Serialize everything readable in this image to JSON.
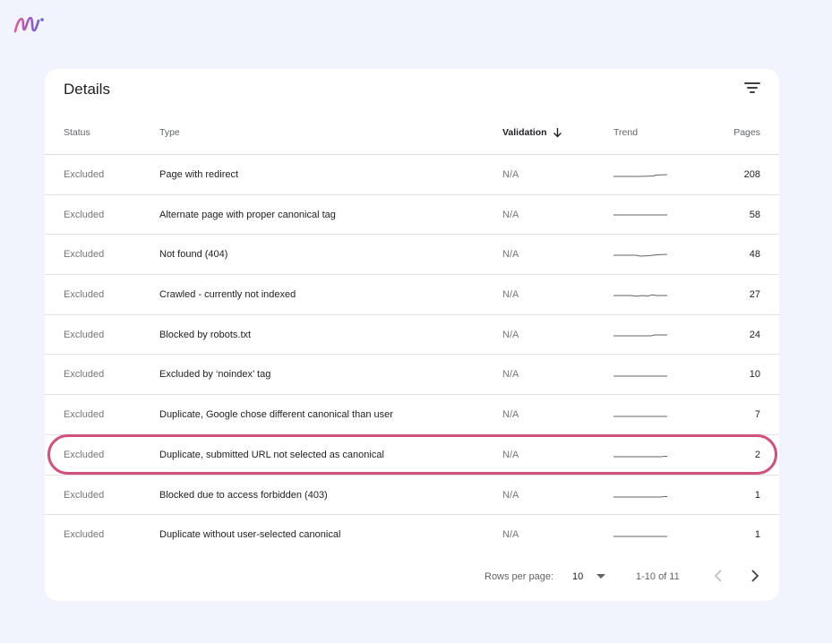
{
  "card": {
    "title": "Details"
  },
  "columns": {
    "status": "Status",
    "type": "Type",
    "validation": "Validation",
    "trend": "Trend",
    "pages": "Pages"
  },
  "rows": [
    {
      "status": "Excluded",
      "type": "Page with redirect",
      "validation": "N/A",
      "pages": "208"
    },
    {
      "status": "Excluded",
      "type": "Alternate page with proper canonical tag",
      "validation": "N/A",
      "pages": "58"
    },
    {
      "status": "Excluded",
      "type": "Not found (404)",
      "validation": "N/A",
      "pages": "48"
    },
    {
      "status": "Excluded",
      "type": "Crawled - currently not indexed",
      "validation": "N/A",
      "pages": "27"
    },
    {
      "status": "Excluded",
      "type": "Blocked by robots.txt",
      "validation": "N/A",
      "pages": "24"
    },
    {
      "status": "Excluded",
      "type": "Excluded by ‘noindex’ tag",
      "validation": "N/A",
      "pages": "10"
    },
    {
      "status": "Excluded",
      "type": "Duplicate, Google chose different canonical than user",
      "validation": "N/A",
      "pages": "7"
    },
    {
      "status": "Excluded",
      "type": "Duplicate, submitted URL not selected as canonical",
      "validation": "N/A",
      "pages": "2"
    },
    {
      "status": "Excluded",
      "type": "Blocked due to access forbidden (403)",
      "validation": "N/A",
      "pages": "1"
    },
    {
      "status": "Excluded",
      "type": "Duplicate without user-selected canonical",
      "validation": "N/A",
      "pages": "1"
    }
  ],
  "footer": {
    "rows_per_page_label": "Rows per page:",
    "rows_per_page_value": "10",
    "range": "1-10 of 11"
  },
  "colors": {
    "highlight": "#d2517c",
    "background": "#f1f4fc",
    "logo_start": "#e2579a",
    "logo_end": "#6f5fd6"
  },
  "icons": {
    "logo": "brand-logo-icon",
    "filter": "filter-icon",
    "sort": "arrow-down-icon",
    "rows_caret": "caret-down-icon",
    "prev": "chevron-left-icon",
    "next": "chevron-right-icon"
  }
}
